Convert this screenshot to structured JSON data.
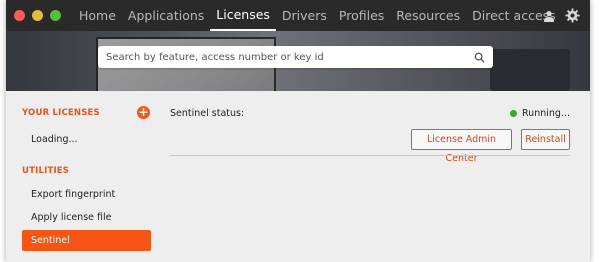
{
  "nav": {
    "items": [
      "Home",
      "Applications",
      "Licenses",
      "Drivers",
      "Profiles",
      "Resources",
      "Direct access"
    ],
    "active": "Licenses"
  },
  "search": {
    "placeholder": "Search by feature, access number or key id"
  },
  "sidebar": {
    "licenses_header": "YOUR LICENSES",
    "add_label": "+",
    "loading": "Loading...",
    "utilities_header": "UTILITIES",
    "utilities": [
      "Export fingerprint",
      "Apply license file",
      "Sentinel"
    ],
    "selected": "Sentinel"
  },
  "main": {
    "status_label": "Sentinel status:",
    "status_value": "Running...",
    "license_admin_button": "License Admin Center",
    "reinstall_button": "Reinstall"
  },
  "colors": {
    "accent": "#f55515",
    "status_ok": "#3ca33c",
    "topbar": "#2a2a2a"
  },
  "icons": [
    "user-icon",
    "gear-icon",
    "search-icon"
  ]
}
